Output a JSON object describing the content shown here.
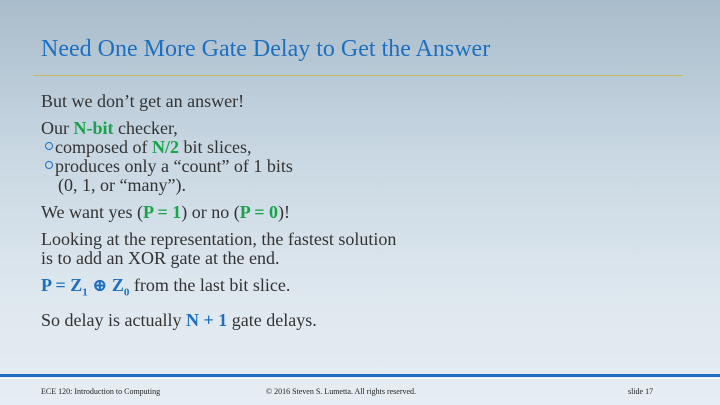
{
  "title": "Need One More Gate Delay to Get the Answer",
  "lines": {
    "l1": "But we don’t get an answer!",
    "l2_a": "Our ",
    "l2_b": "N-bit",
    "l2_c": " checker,",
    "l3_a": "composed of ",
    "l3_b": "N/2",
    "l3_c": " bit slices,",
    "l4": "produces only a “count” of 1 bits",
    "l5": "(0, 1, or “many”).",
    "l6_a": "We want yes (",
    "l6_b": "P = 1",
    "l6_c": ") or no (",
    "l6_d": "P = 0",
    "l6_e": ")!",
    "l7": "Looking at the representation, the fastest solution",
    "l8": "is to add an XOR gate at the end.",
    "l9_a": "P = Z",
    "l9_s1": "1",
    "l9_b": " ⊕ Z",
    "l9_s0": "0",
    "l9_c": " from the last bit slice.",
    "l10_a": "So delay is actually ",
    "l10_b": "N + 1",
    "l10_c": " gate delays."
  },
  "footer": {
    "course": "ECE 120: Introduction to Computing",
    "copyright": "© 2016 Steven S. Lumetta.  All rights reserved.",
    "slide": "slide 17"
  },
  "colors": {
    "title": "#1f6fbf",
    "green_emphasis": "#19a34a",
    "blue_emphasis": "#1f6fbf",
    "rule": "#c9b760"
  }
}
